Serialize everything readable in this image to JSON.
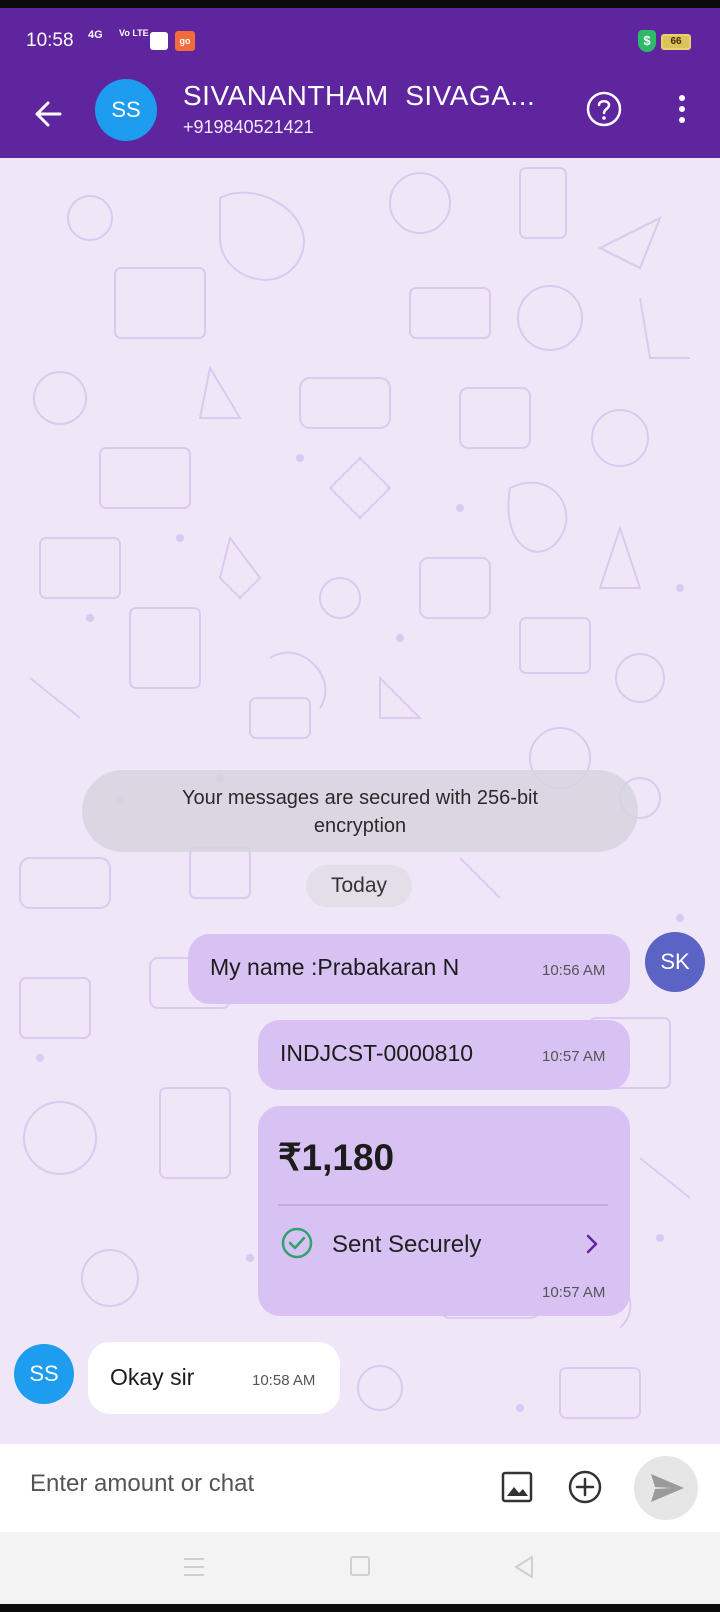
{
  "status_bar": {
    "time": "10:58",
    "signal_label": "4G",
    "volte_label": "Vo LTE",
    "app_badge": "go",
    "battery": "66"
  },
  "header": {
    "avatar_initials": "SS",
    "contact_name": "SIVANANTHAM  SIVAGA...",
    "contact_phone": "+919840521421",
    "icons": [
      "back-arrow-icon",
      "help-icon",
      "more-vert-icon"
    ]
  },
  "chat": {
    "encryption_notice": "Your messages are secured with 256-bit encryption",
    "date_chip": "Today",
    "sender_avatar": "SK",
    "receiver_avatar": "SS",
    "messages": [
      {
        "direction": "out",
        "text": "My name :Prabakaran N",
        "time": "10:56 AM"
      },
      {
        "direction": "out",
        "text": "INDJCST-0000810",
        "time": "10:57 AM"
      },
      {
        "direction": "out",
        "type": "payment",
        "amount": "₹1,180",
        "status": "Sent Securely",
        "time": "10:57 AM"
      },
      {
        "direction": "in",
        "text": "Okay sir",
        "time": "10:58 AM"
      }
    ]
  },
  "composer": {
    "placeholder": "Enter amount or chat"
  },
  "colors": {
    "brand": "#5f259f",
    "outgoing_bubble": "#d8c2f3",
    "chat_bg": "#efe7f8",
    "success": "#2fa36b"
  }
}
